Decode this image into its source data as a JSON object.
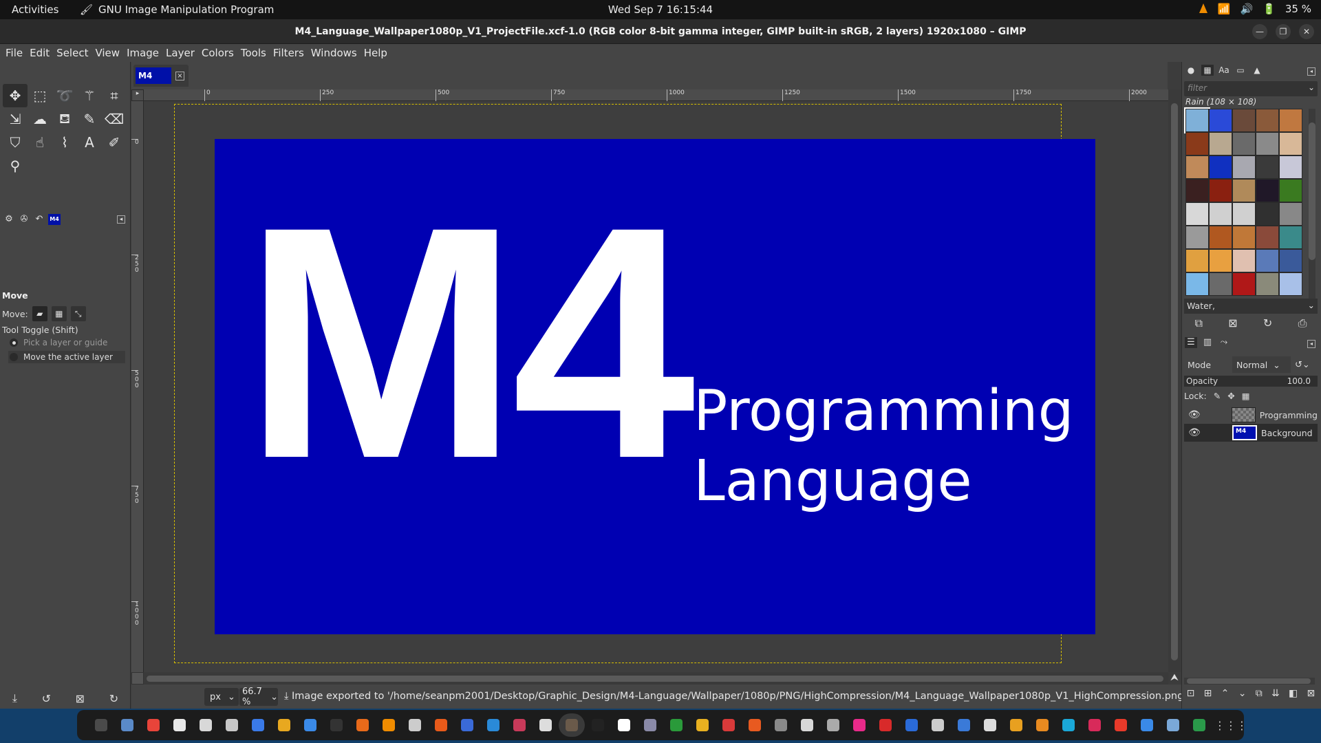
{
  "topbar": {
    "activities": "Activities",
    "app_name": "GNU Image Manipulation Program",
    "clock": "Wed Sep 7  16:15:44",
    "battery": "35 %"
  },
  "window": {
    "title": "M4_Language_Wallpaper1080p_V1_ProjectFile.xcf-1.0 (RGB color 8-bit gamma integer, GIMP built-in sRGB, 2 layers) 1920x1080 – GIMP"
  },
  "menubar": {
    "items": [
      "File",
      "Edit",
      "Select",
      "View",
      "Image",
      "Layer",
      "Colors",
      "Tools",
      "Filters",
      "Windows",
      "Help"
    ]
  },
  "toolbox": {
    "tools": [
      "move-tool-icon",
      "rect-select-icon",
      "lasso-icon",
      "fuzzy-select-icon",
      "crop-icon",
      "unified-transform-icon",
      "warp-icon",
      "bucket-fill-icon",
      "paintbrush-icon",
      "eraser-icon",
      "clone-icon",
      "smudge-icon",
      "paths-icon",
      "text-icon",
      "color-picker-icon",
      "zoom-icon"
    ],
    "fg_color": "#ffffff",
    "bg_color": "#1aa5d4"
  },
  "tool_options": {
    "title": "Move",
    "move_label": "Move:",
    "toggle_label": "Tool Toggle  (Shift)",
    "option_pick": "Pick a layer or guide",
    "option_move": "Move the active layer"
  },
  "image_tab": {
    "thumb_text": "M4"
  },
  "rulers": {
    "h_ticks": [
      "0",
      "250",
      "500",
      "750",
      "1000",
      "1250",
      "1500",
      "1750",
      "2000"
    ],
    "v_ticks": [
      "0",
      "250",
      "500",
      "750",
      "1000"
    ]
  },
  "canvas": {
    "big_text": "M4",
    "line1": "Programming",
    "line2": "Language",
    "bg_color": "#0000b2"
  },
  "statusbar": {
    "unit": "px",
    "zoom": "66.7 %",
    "message": "Image exported to '/home/seanpm2001/Desktop/Graphic_Design/M4-Language/Wallpaper/1080p/PNG/HighCompression/M4_Language_Wallpaper1080p_V1_HighCompression.png'"
  },
  "patterns": {
    "filter_placeholder": "filter",
    "selected_label": "Rain (108 × 108)",
    "current": "Water,",
    "swatch_colors": [
      "#7fb0d8",
      "#2a4ad8",
      "#6a4a3a",
      "#8a5a3a",
      "#c07840",
      "#8a3a1a",
      "#b8a890",
      "#6a6a6a",
      "#8a8a8a",
      "#d8b898",
      "#c08a5a",
      "#1030c0",
      "#a8a8b0",
      "#3a3a3a",
      "#c8c8d8",
      "#3a2020",
      "#8a2010",
      "#b08a5a",
      "#201828",
      "#3a7a20",
      "#d8d8d8",
      "#d0d0d0",
      "#d0d0d0",
      "#303030",
      "#888888",
      "#9a9a9a",
      "#b05820",
      "#c07838",
      "#8a4a3a",
      "#3a8a8a",
      "#e0a040",
      "#e8a040",
      "#e0c0b0",
      "#5a7ab8",
      "#3a5a9a",
      "#7ab8e8",
      "#6a6a6a",
      "#b01818",
      "#8a8a7a",
      "#a8c0e8"
    ]
  },
  "layers": {
    "mode_label": "Mode",
    "mode_value": "Normal",
    "opacity_label": "Opacity",
    "opacity_value": "100.0",
    "lock_label": "Lock:",
    "items": [
      {
        "name": "Programming",
        "thumb": ""
      },
      {
        "name": "Background",
        "thumb": "M4"
      }
    ]
  },
  "taskbar": {
    "icons": [
      {
        "name": "terminal-app-icon",
        "color": "#4a4a4a"
      },
      {
        "name": "files-app-icon",
        "color": "#5a8ac8"
      },
      {
        "name": "chrome-app-icon",
        "color": "#e8443a"
      },
      {
        "name": "notes-app-icon",
        "color": "#e8e8e8"
      },
      {
        "name": "document-app-icon",
        "color": "#d8d8d8"
      },
      {
        "name": "screenshot-app-icon",
        "color": "#c8c8c8"
      },
      {
        "name": "writer-app-icon",
        "color": "#3a7ae8"
      },
      {
        "name": "calc-app-icon",
        "color": "#e8a820"
      },
      {
        "name": "editor-app-icon",
        "color": "#3a8ae8"
      },
      {
        "name": "console-app-icon",
        "color": "#333333"
      },
      {
        "name": "firefox-app-icon",
        "color": "#e86a1a"
      },
      {
        "name": "vlc-app-icon",
        "color": "#f08c00"
      },
      {
        "name": "obs-app-icon",
        "color": "#cccccc"
      },
      {
        "name": "software-app-icon",
        "color": "#e85a1a"
      },
      {
        "name": "blue-app-icon",
        "color": "#3a6ad8"
      },
      {
        "name": "help-app-icon",
        "color": "#2a8ad8"
      },
      {
        "name": "monitor-app-icon",
        "color": "#c83a5a"
      },
      {
        "name": "recorder-app-icon",
        "color": "#dddddd"
      },
      {
        "name": "gimp-app-icon",
        "color": "#6a5a4a"
      },
      {
        "name": "inkscape-app-icon",
        "color": "#222222"
      },
      {
        "name": "blender-app-icon",
        "color": "#ffffff"
      },
      {
        "name": "disc-app-icon",
        "color": "#8a8aa8"
      },
      {
        "name": "sheet-app-icon",
        "color": "#2a9a3a"
      },
      {
        "name": "folder-app-icon",
        "color": "#e8b020"
      },
      {
        "name": "pdf-app-icon",
        "color": "#d83a3a"
      },
      {
        "name": "tasks-app-icon",
        "color": "#e85a20"
      },
      {
        "name": "clock-app-icon",
        "color": "#8a8a8a"
      },
      {
        "name": "news-app-icon",
        "color": "#d8d8d8"
      },
      {
        "name": "vim-app-icon",
        "color": "#aaaaaa"
      },
      {
        "name": "pink-app-icon",
        "color": "#e82a8a"
      },
      {
        "name": "calendar-app-icon",
        "color": "#d82a2a"
      },
      {
        "name": "window-app-icon",
        "color": "#2a6ad8"
      },
      {
        "name": "settings-app-icon",
        "color": "#cccccc"
      },
      {
        "name": "tiles-app-icon",
        "color": "#3a7ad8"
      },
      {
        "name": "camera-app-icon",
        "color": "#dddddd"
      },
      {
        "name": "rocket-app-icon",
        "color": "#e8a020"
      },
      {
        "name": "character-app-icon",
        "color": "#e88a20"
      },
      {
        "name": "c-app-icon",
        "color": "#1aa8d8"
      },
      {
        "name": "swirl-app-icon",
        "color": "#d82a5a"
      },
      {
        "name": "red-dot-app-icon",
        "color": "#e83a2a"
      },
      {
        "name": "bird-app-icon",
        "color": "#3a8ae8"
      },
      {
        "name": "window2-app-icon",
        "color": "#7aa8d8"
      },
      {
        "name": "recycle-app-icon",
        "color": "#2a9a4a"
      }
    ]
  }
}
